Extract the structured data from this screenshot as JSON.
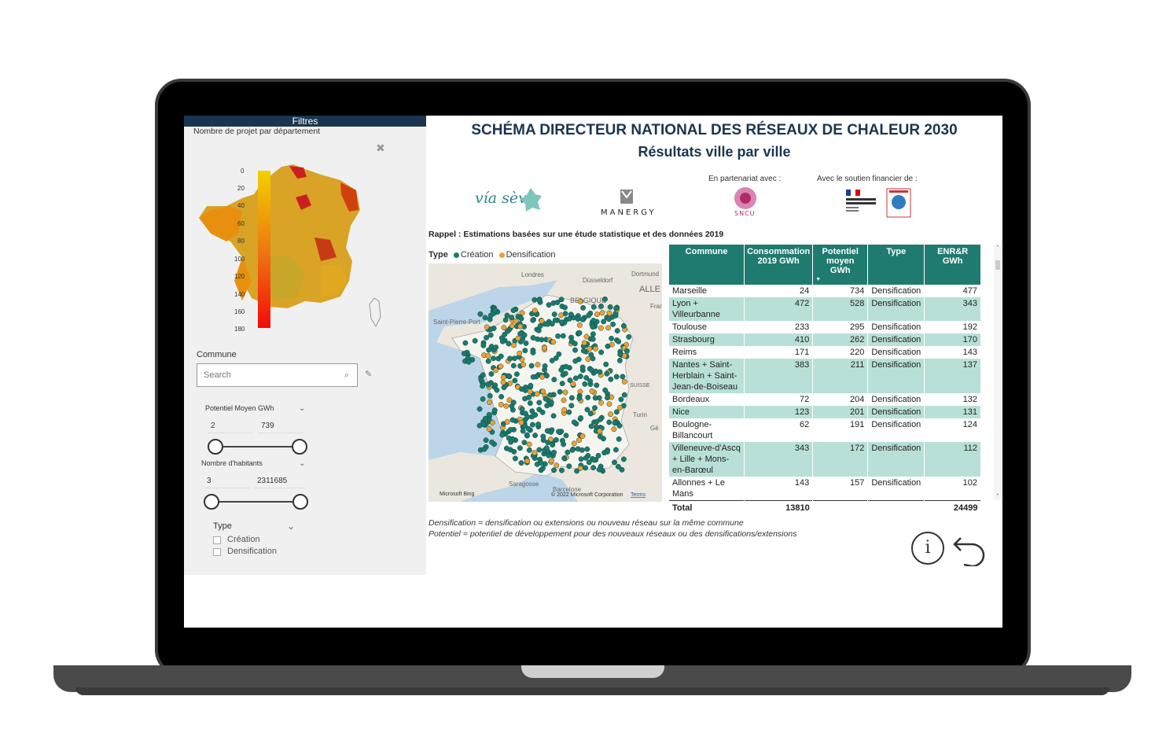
{
  "filters": {
    "header": "Filtres",
    "map_title": "Nombre de projet par département",
    "gradient_ticks": [
      "0",
      "20",
      "40",
      "60",
      "80",
      "100",
      "120",
      "140",
      "160",
      "180"
    ],
    "commune_label": "Commune",
    "search_placeholder": "Search",
    "potentiel": {
      "label": "Potentiel Moyen GWh",
      "min": "2",
      "max": "739"
    },
    "habitants": {
      "label": "Nombre d'habitants",
      "min": "3",
      "max": "2311685"
    },
    "type": {
      "label": "Type",
      "options": [
        "Création",
        "Densification"
      ]
    }
  },
  "main": {
    "title": "SCHÉMA DIRECTEUR NATIONAL DES RÉSEAUX DE CHALEUR 2030",
    "subtitle": "Résultats ville par ville",
    "partner_label": "En partenariat avec :",
    "support_label": "Avec le soutien financier de :",
    "logo_viaseva": "vía sèva",
    "logo_manergy": "MANERGY",
    "logo_sncu": "SNCU",
    "rappel": "Rappel : Estimations basées sur une étude statistique et des données 2019",
    "legend_title": "Type",
    "legend_creation": "Création",
    "legend_densification": "Densification",
    "map_labels": {
      "londres": "Londres",
      "dusseldorf": "Düsseldorf",
      "dortmund": "Dortmund",
      "belgique": "BELGIQUE",
      "alle": "ALLE",
      "saintpierre": "Saint-Pierre-Port",
      "fran": "Fran",
      "suisse": "SUISSE",
      "turin": "Turin",
      "ge": "Gè",
      "barcelone": "Barcelone",
      "saragosse": "Saragosse",
      "credit": "© 2022 Microsoft Corporation",
      "terms": "Terms",
      "bing": "Microsoft Bing"
    },
    "note1": "Densification = densification ou extensions ou nouveau réseau sur la même commune",
    "note2": "Potentiel = potentiel de développement pour des nouveaux réseaux ou des densifications/extensions"
  },
  "table": {
    "headers": [
      "Commune",
      "Consommation 2019 GWh",
      "Potentiel moyen GWh",
      "Type",
      "ENR&R GWh"
    ],
    "rows": [
      [
        "Marseille",
        "24",
        "734",
        "Densification",
        "477"
      ],
      [
        "Lyon + Villeurbanne",
        "472",
        "528",
        "Densification",
        "343"
      ],
      [
        "Toulouse",
        "233",
        "295",
        "Densification",
        "192"
      ],
      [
        "Strasbourg",
        "410",
        "262",
        "Densification",
        "170"
      ],
      [
        "Reims",
        "171",
        "220",
        "Densification",
        "143"
      ],
      [
        "Nantes + Saint-Herblain + Saint-Jean-de-Boiseau",
        "383",
        "211",
        "Densification",
        "137"
      ],
      [
        "Bordeaux",
        "72",
        "204",
        "Densification",
        "132"
      ],
      [
        "Nice",
        "123",
        "201",
        "Densification",
        "131"
      ],
      [
        "Boulogne-Billancourt",
        "62",
        "191",
        "Densification",
        "124"
      ],
      [
        "Villeneuve-d'Ascq + Lille + Mons-en-Barœul",
        "343",
        "172",
        "Densification",
        "112"
      ],
      [
        "Allonnes + Le Mans",
        "143",
        "157",
        "Densification",
        "102"
      ]
    ],
    "total_label": "Total",
    "total_conso": "13810",
    "total_enr": "24499"
  },
  "colors": {
    "teal": "#1f7b6f",
    "creation": "#1a7a6d",
    "densification": "#f0a030",
    "navy": "#1a3550",
    "alt_row": "#b8e0d8"
  },
  "icons": [
    "search-icon",
    "eraser-icon",
    "chevron-down-icon",
    "close-icon",
    "info-icon",
    "back-arrow-icon"
  ]
}
